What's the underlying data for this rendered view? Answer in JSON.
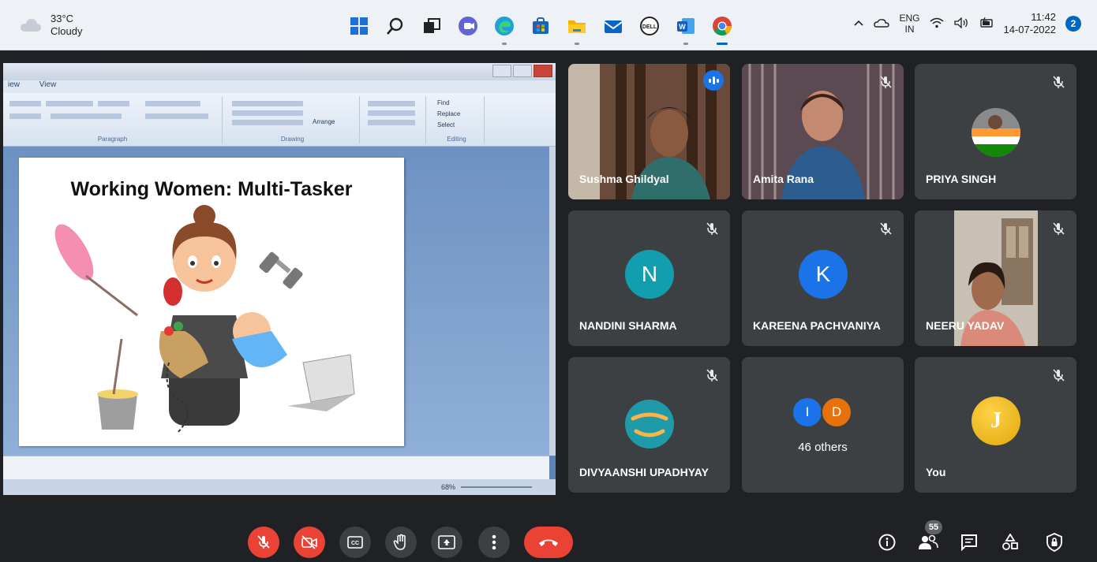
{
  "taskbar": {
    "weather_temp": "33°C",
    "weather_desc": "Cloudy",
    "lang_top": "ENG",
    "lang_bottom": "IN",
    "time": "11:42",
    "date": "14-07-2022",
    "notification_count": "2",
    "apps": [
      "windows-start-icon",
      "search-icon",
      "task-view-icon",
      "teams-chat-icon",
      "edge-icon",
      "store-icon",
      "file-explorer-icon",
      "mail-icon",
      "dell-icon",
      "word-icon",
      "chrome-icon"
    ]
  },
  "shared_screen": {
    "ribbon_tabs": [
      "iew",
      "View"
    ],
    "groups": [
      "Paragraph",
      "Drawing",
      "Editing"
    ],
    "editing": [
      "Find",
      "Replace",
      "Select"
    ],
    "arrange_label": "Arrange",
    "zoom": "68%",
    "slide_title": "Working Women: Multi-Tasker"
  },
  "participants": [
    {
      "name": "Sushma Ghildyal",
      "type": "video",
      "speaking": true
    },
    {
      "name": "Amita Rana",
      "type": "video",
      "muted": true
    },
    {
      "name": "PRIYA SINGH",
      "type": "image",
      "muted": true
    },
    {
      "name": "NANDINI SHARMA",
      "initial": "N",
      "color": "#129eaf",
      "muted": true
    },
    {
      "name": "KAREENA PACHVANIYA",
      "initial": "K",
      "color": "#1a73e8",
      "muted": true
    },
    {
      "name": "NEERU YADAV",
      "type": "video",
      "muted": true
    },
    {
      "name": "DIVYAANSHI UPADHYAY",
      "type": "image",
      "muted": true
    },
    {
      "others_label": "46 others",
      "initials": [
        "I",
        "D"
      ],
      "colors": [
        "#1a73e8",
        "#e8710a"
      ]
    },
    {
      "name": "You",
      "initial": "J",
      "type": "image",
      "muted": true
    }
  ],
  "controls": {
    "people_count": "55",
    "buttons": [
      "mic-off",
      "camera-off",
      "captions",
      "raise-hand",
      "present",
      "more-options",
      "end-call"
    ],
    "right": [
      "info",
      "people",
      "chat",
      "activities",
      "host-controls"
    ]
  },
  "colors": {
    "meet_bg": "#202124",
    "tile_bg": "#3c4043",
    "danger": "#ea4335",
    "speaking_outline": "#8ab4f8"
  }
}
